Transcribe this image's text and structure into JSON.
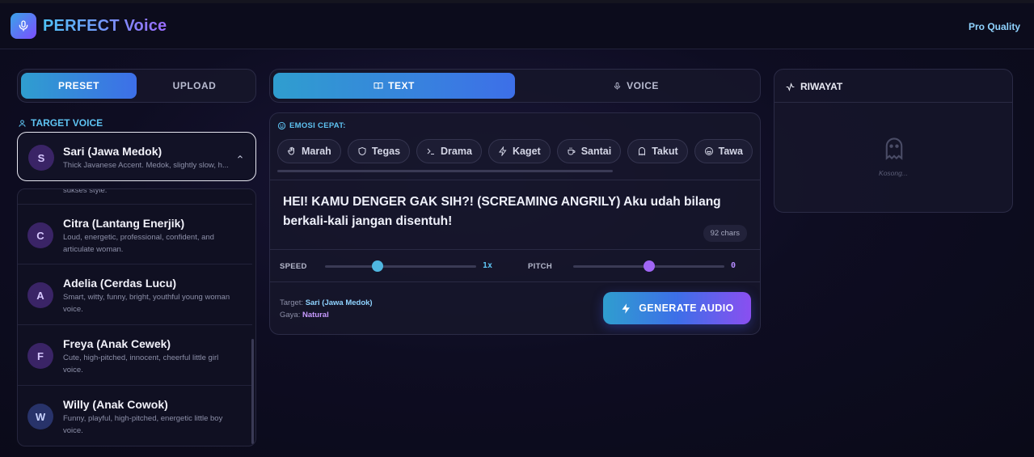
{
  "app": {
    "title": "PERFECT Voice",
    "badge": "Pro Quality"
  },
  "left": {
    "tabs": [
      {
        "label": "PRESET",
        "active": true
      },
      {
        "label": "UPLOAD",
        "active": false
      }
    ],
    "target_label": "TARGET VOICE",
    "selected": {
      "initial": "S",
      "name": "Sari (Jawa Medok)",
      "desc": "Thick Javanese Accent. Medok, slightly slow, h..."
    },
    "clipped_text": "sukses style.",
    "voices": [
      {
        "initial": "C",
        "name": "Citra (Lantang Enerjik)",
        "desc": "Loud, energetic, professional, confident, and articulate woman."
      },
      {
        "initial": "A",
        "name": "Adelia (Cerdas Lucu)",
        "desc": "Smart, witty, funny, bright, youthful young woman voice."
      },
      {
        "initial": "F",
        "name": "Freya (Anak Cewek)",
        "desc": "Cute, high-pitched, innocent, cheerful little girl voice."
      },
      {
        "initial": "W",
        "name": "Willy (Anak Cowok)",
        "desc": "Funny, playful, high-pitched, energetic little boy voice."
      }
    ]
  },
  "middle": {
    "tabs": [
      {
        "label": "TEXT",
        "icon": "book-icon",
        "active": true
      },
      {
        "label": "VOICE",
        "icon": "mic-icon",
        "active": false
      }
    ],
    "emosi_label": "EMOSI CEPAT:",
    "chips": [
      {
        "label": "Marah",
        "icon": "hand-icon"
      },
      {
        "label": "Tegas",
        "icon": "shield-icon"
      },
      {
        "label": "Drama",
        "icon": "terminal-icon"
      },
      {
        "label": "Kaget",
        "icon": "zap-icon"
      },
      {
        "label": "Santai",
        "icon": "coffee-icon"
      },
      {
        "label": "Takut",
        "icon": "ghost-icon"
      },
      {
        "label": "Tawa",
        "icon": "laugh-icon"
      }
    ],
    "text": "HEI! KAMU DENGER GAK SIH?! (SCREAMING ANGRILY) Aku udah bilang berkali-kali jangan disentuh!",
    "chars": "92 chars",
    "speed": {
      "label": "SPEED",
      "value": "1x",
      "level": 0.35
    },
    "pitch": {
      "label": "PITCH",
      "value": "0",
      "level": 0.5
    },
    "meta": {
      "target_label": "Target:",
      "target_value": "Sari (Jawa Medok)",
      "gaya_label": "Gaya:",
      "gaya_value": "Natural"
    },
    "generate_label": "GENERATE AUDIO"
  },
  "right": {
    "title": "RIWAYAT",
    "empty": "Kosong..."
  },
  "colors": {
    "accent_cyan": "#5ec3f2",
    "accent_purple": "#9b6bff",
    "speed_thumb": "#4fb6e0",
    "pitch_thumb": "#a066f5"
  }
}
